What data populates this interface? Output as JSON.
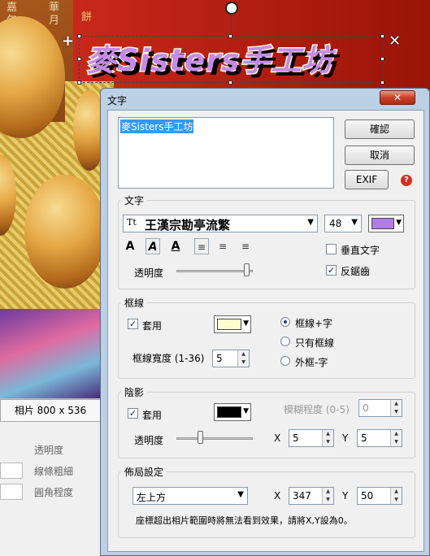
{
  "photo": {
    "overlay_text": "麥Sisters手工坊",
    "wrapper_chars": [
      "嘉",
      "年",
      "華",
      "月",
      "餅"
    ]
  },
  "side_panel": {
    "photo_size": "相片 800 x 536",
    "opacity_label": "透明度",
    "line_width_label": "線條粗細",
    "corner_label": "圓角程度"
  },
  "dialog": {
    "title": "文字",
    "close_glyph": "✕",
    "text_value": "麥Sisters手工坊",
    "ok_label": "確認",
    "cancel_label": "取消",
    "exif_label": "EXIF",
    "help_glyph": "?",
    "text_group": {
      "title": "文字",
      "font": "王漢宗勘亭流繁",
      "font_icon": "Tt",
      "size": "48",
      "color": "#b07ce8",
      "bold": "A",
      "italic": "A",
      "underline": "A",
      "vertical_label": "垂直文字",
      "vertical_checked": false,
      "antialias_label": "反鋸齒",
      "antialias_checked": true,
      "opacity_label": "透明度",
      "opacity_value": 0.95
    },
    "border_group": {
      "title": "框線",
      "apply_label": "套用",
      "apply_checked": true,
      "color": "#fdfbd0",
      "width_label": "框線寬度 (1-36)",
      "width_value": "5",
      "options": [
        "框線+字",
        "只有框線",
        "外框-字"
      ],
      "selected_option": 0
    },
    "shadow_group": {
      "title": "陰影",
      "apply_label": "套用",
      "apply_checked": true,
      "color": "#000000",
      "blur_label": "模糊程度 (0-5)",
      "blur_value": "0",
      "opacity_label": "透明度",
      "opacity_value": 0.3,
      "x_label": "X",
      "x_value": "5",
      "y_label": "Y",
      "y_value": "5"
    },
    "layout_group": {
      "title": "佈局設定",
      "position": "左上方",
      "x_label": "X",
      "x_value": "347",
      "y_label": "Y",
      "y_value": "50",
      "note": "座標超出相片範圍時將無法看到效果，請將X,Y設為0。"
    }
  }
}
